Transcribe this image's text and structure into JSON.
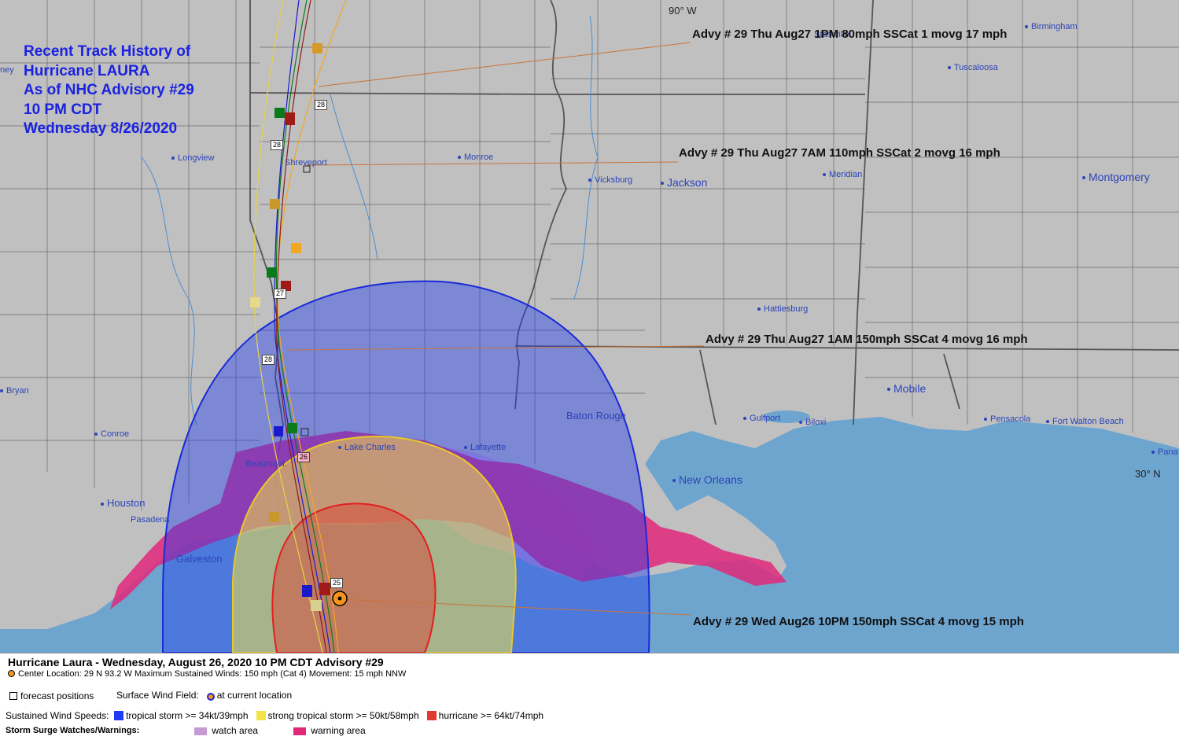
{
  "title_block": {
    "lines": [
      "Recent Track History of",
      "Hurricane LAURA",
      "As of NHC Advisory #29",
      "10 PM CDT",
      "Wednesday 8/26/2020"
    ]
  },
  "graticule": {
    "lon": "90° W",
    "lat": "30° N"
  },
  "cities": [
    {
      "name": "Birmingham"
    },
    {
      "name": "Tuscaloosa"
    },
    {
      "name": "Starkville"
    },
    {
      "name": "Shreveport"
    },
    {
      "name": "Longview"
    },
    {
      "name": "Monroe"
    },
    {
      "name": "Vicksburg"
    },
    {
      "name": "Jackson"
    },
    {
      "name": "Meridian"
    },
    {
      "name": "Montgomery"
    },
    {
      "name": "Hattiesburg"
    },
    {
      "name": "Mobile"
    },
    {
      "name": "Bryan"
    },
    {
      "name": "Conroe"
    },
    {
      "name": "Baton Rouge"
    },
    {
      "name": "Lake Charles"
    },
    {
      "name": "Lafayette"
    },
    {
      "name": "Beaumont"
    },
    {
      "name": "Houston"
    },
    {
      "name": "Pasadena"
    },
    {
      "name": "Gulfport"
    },
    {
      "name": "Biloxi"
    },
    {
      "name": "Pensacola"
    },
    {
      "name": "Fort Walton Beach"
    },
    {
      "name": "Pana"
    },
    {
      "name": "New Orleans"
    },
    {
      "name": "Galveston"
    },
    {
      "name": "ney"
    }
  ],
  "advisories": [
    "Advy # 29 Thu Aug27 1PM  80mph SSCat 1 movg 17 mph",
    "Advy # 29 Thu Aug27 7AM  110mph SSCat 2 movg 16 mph",
    "Advy # 29 Thu Aug27 1AM  150mph SSCat 4 movg 16 mph",
    "Advy # 29 Wed Aug26 10PM  150mph SSCat 4 movg 15 mph"
  ],
  "track_tags": [
    "28",
    "28",
    "27",
    "28",
    "26",
    "25"
  ],
  "legend": {
    "header": "Hurricane Laura  -  Wednesday, August 26, 2020  10 PM CDT   Advisory #29",
    "center_line": "Center Location: 29 N  93.2 W   Maximum Sustained Winds: 150 mph (Cat 4) Movement: 15 mph NNW",
    "forecast_positions": "forecast positions",
    "surface_wind_field": "Surface Wind Field:",
    "at_current_location": "at current location",
    "sustained_label": "Sustained Wind Speeds:",
    "tropical_storm": "tropical storm >= 34kt/39mph",
    "strong_tropical_storm": "strong tropical storm >= 50kt/58mph",
    "hurricane": "hurricane >= 64kt/74mph",
    "surge_label": "Storm Surge Watches/Warnings:",
    "watch_area": "watch area",
    "warning_area": "warning area"
  },
  "colors": {
    "land": "#c0c0c0",
    "water": "#6ea5cf",
    "tropical_storm": "#1f3cf0",
    "strong_tropical_storm": "#f2e447",
    "hurricane": "#e03a2f",
    "surge_watch": "#c49bd2",
    "surge_warning": "#e0287a",
    "title_blue": "#1a22e0"
  }
}
